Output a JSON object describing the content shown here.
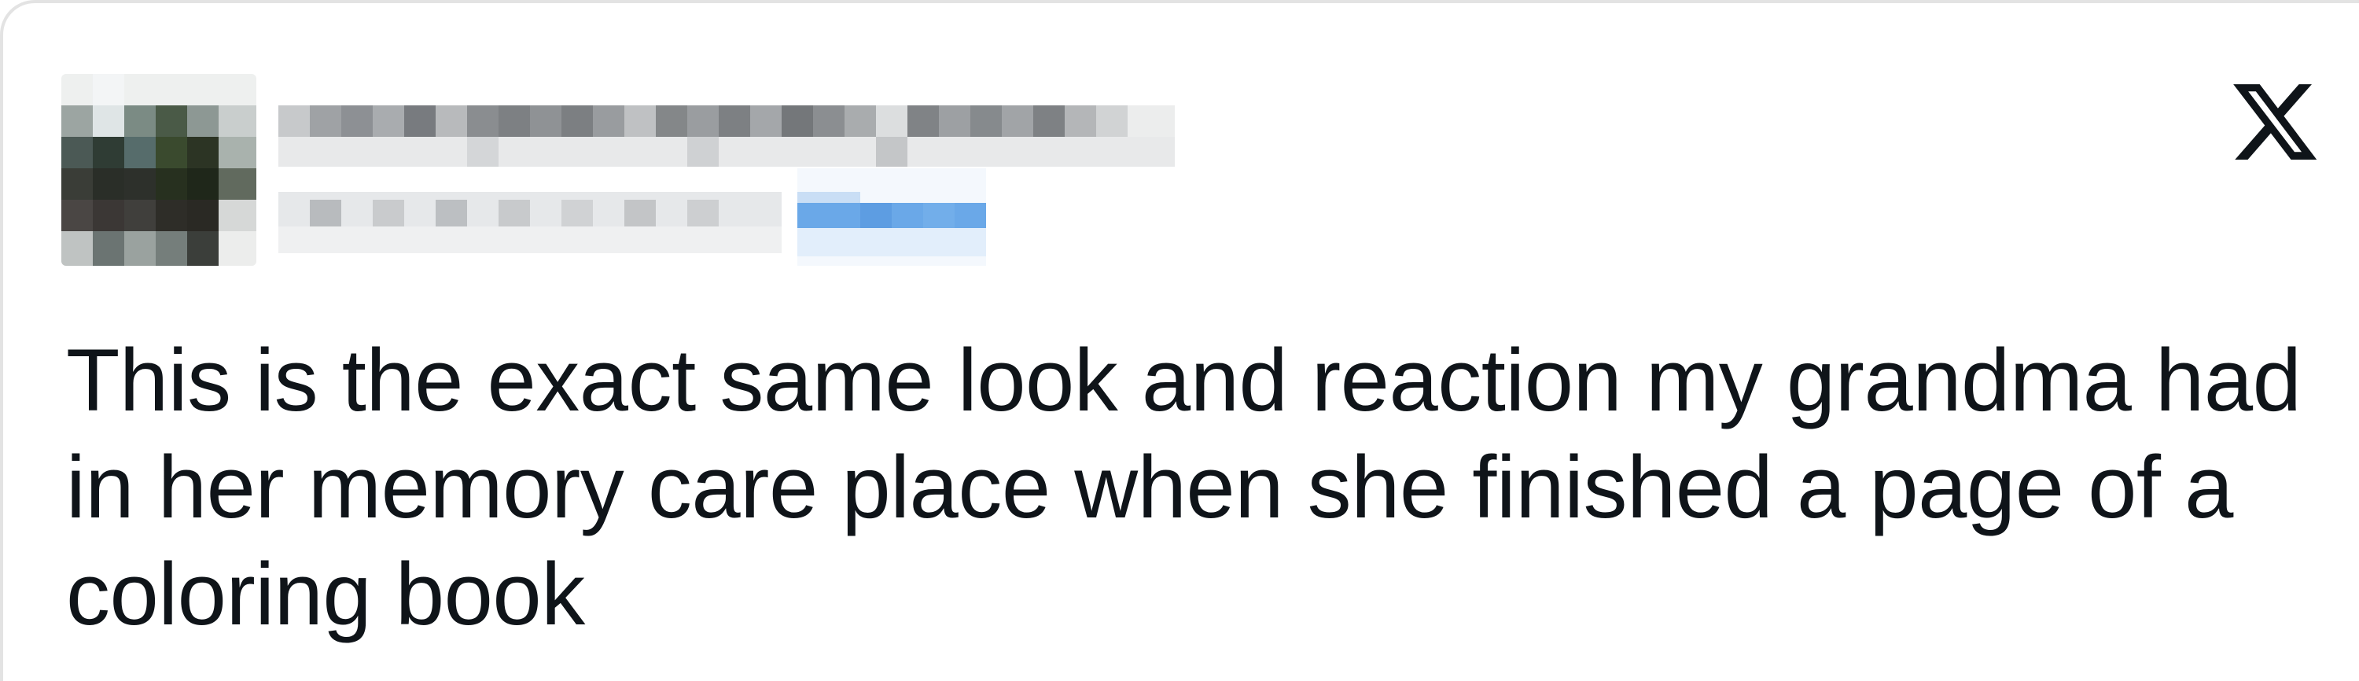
{
  "post": {
    "platform_icon": "x-logo-icon",
    "author_avatar": "pixelated-avatar",
    "author_name": "",
    "author_handle": "",
    "text": "This is the exact same look and reaction my grandma had\nin her memory care place when she finished a page of a\ncoloring book"
  },
  "colors": {
    "text": "#0f1419",
    "border": "#e3e3e3",
    "link": "#6aa8e8"
  }
}
